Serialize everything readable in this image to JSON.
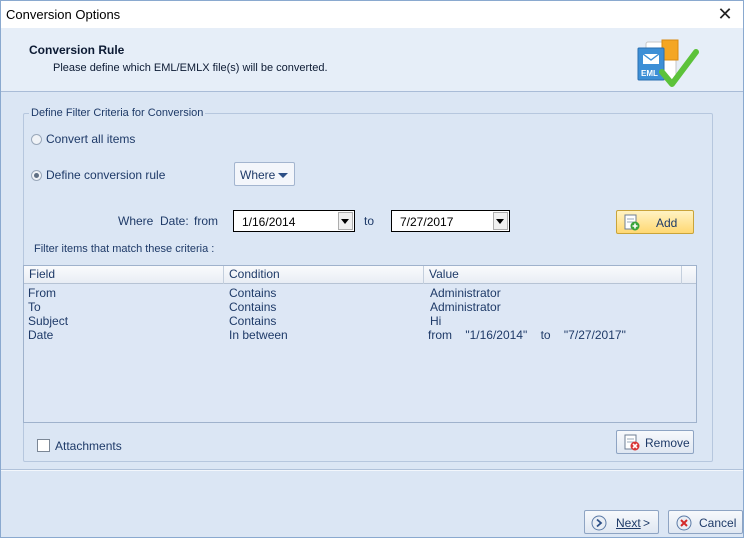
{
  "window": {
    "title": "Conversion Options",
    "close_label": "✕"
  },
  "header": {
    "title": "Conversion Rule",
    "subtitle": "Please define which EML/EMLX file(s) will be converted.",
    "icon_text": "EML",
    "icon": "eml-check-icon"
  },
  "filter": {
    "legend": "Define Filter Criteria for Conversion",
    "option_all": "Convert all items",
    "option_rule": "Define conversion rule",
    "selected_option": "rule",
    "where_label": "Where",
    "where_text": "Where",
    "date_text": "Date:",
    "from_text": "from",
    "from_value": "1/16/2014",
    "to_text": "to",
    "to_value": "7/27/2017",
    "add_label": "Add",
    "match_text": "Filter items that match these criteria :"
  },
  "grid": {
    "columns": [
      "Field",
      "Condition",
      "Value"
    ],
    "rows": [
      {
        "field": "From",
        "condition": "Contains",
        "value": "Administrator"
      },
      {
        "field": "To",
        "condition": "Contains",
        "value": "Administrator"
      },
      {
        "field": "Subject",
        "condition": "Contains",
        "value": "Hi"
      },
      {
        "field": "Date",
        "condition": "In between",
        "value": "from    \"1/16/2014\"    to    \"7/27/2017\""
      }
    ]
  },
  "attachments": {
    "label": "Attachments",
    "checked": false
  },
  "buttons": {
    "remove_label": "Remove",
    "next_label": "Next",
    "next_suffix": ">",
    "cancel_label": "Cancel"
  },
  "colors": {
    "accent": "#1e3a68",
    "panel": "#dbe6f4",
    "add_button": "#ffd872",
    "check_green": "#5cc23a"
  }
}
